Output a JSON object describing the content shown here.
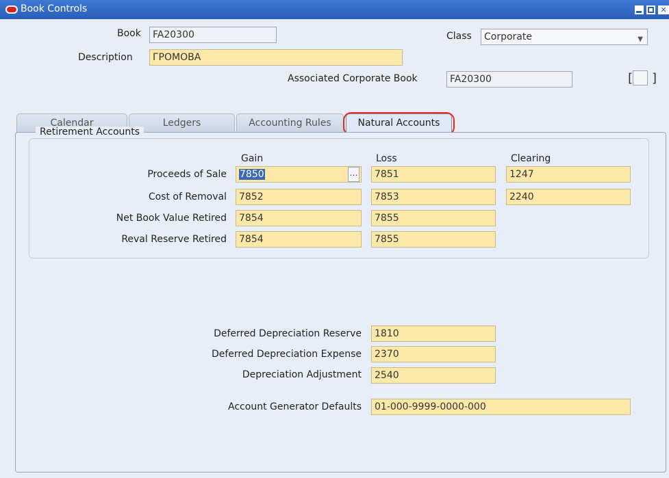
{
  "window": {
    "title": "Book Controls"
  },
  "header": {
    "book_label": "Book",
    "book_value": "FA20300",
    "class_label": "Class",
    "class_value": "Corporate",
    "description_label": "Description",
    "description_value": "ГРОМОВА",
    "assoc_label": "Associated Corporate Book",
    "assoc_value": "FA20300"
  },
  "tabs": [
    {
      "label": "Calendar"
    },
    {
      "label": "Ledgers"
    },
    {
      "label": "Accounting Rules"
    },
    {
      "label": "Natural Accounts"
    }
  ],
  "active_tab": "Natural Accounts",
  "retirement": {
    "title": "Retirement Accounts",
    "columns": [
      "Gain",
      "Loss",
      "Clearing"
    ],
    "rows": [
      {
        "label": "Proceeds of Sale",
        "gain": "7850",
        "loss": "7851",
        "clearing": "1247"
      },
      {
        "label": "Cost of Removal",
        "gain": "7852",
        "loss": "7853",
        "clearing": "2240"
      },
      {
        "label": "Net Book Value Retired",
        "gain": "7854",
        "loss": "7855"
      },
      {
        "label": "Reval Reserve Retired",
        "gain": "7854",
        "loss": "7855"
      }
    ]
  },
  "deferred": [
    {
      "label": "Deferred Depreciation Reserve",
      "value": "1810"
    },
    {
      "label": "Deferred Depreciation Expense",
      "value": "2370"
    },
    {
      "label": "Depreciation Adjustment",
      "value": "2540"
    }
  ],
  "generator": {
    "label": "Account Generator Defaults",
    "value": "01-000-9999-0000-000"
  },
  "colors": {
    "titlebar": "#2a5db8",
    "required_field": "#fce8a8",
    "highlight": "#e02a1e"
  }
}
